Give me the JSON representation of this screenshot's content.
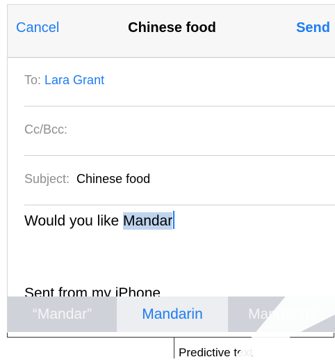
{
  "navbar": {
    "cancel_label": "Cancel",
    "title": "Chinese food",
    "send_label": "Send"
  },
  "fields": {
    "to_label": "To:",
    "to_value": "Lara Grant",
    "cc_label": "Cc/Bcc:",
    "subject_label": "Subject:",
    "subject_value": "Chinese food"
  },
  "body": {
    "text_before": "Would you like ",
    "selected_word": "Mandar",
    "signature": "Sent from my iPhone"
  },
  "predictive_bar": {
    "items": [
      "“Mandar”",
      "Mandarin",
      "Mandarins"
    ]
  },
  "callout": {
    "label": "Predictive text"
  },
  "colors": {
    "accent": "#1d7cf2",
    "selection": "#bfd4ee",
    "keyboard_bar": "#cfd2d8"
  }
}
